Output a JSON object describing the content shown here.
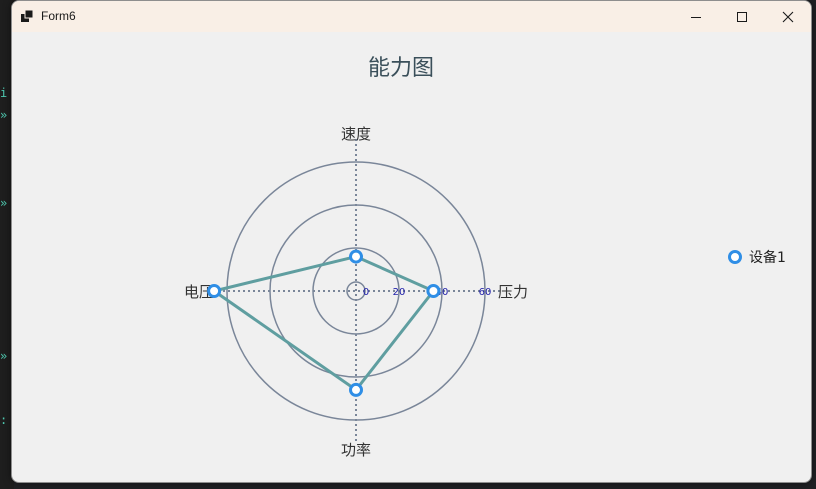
{
  "window": {
    "title": "Form6",
    "controls": [
      "minimize-icon",
      "maximize-icon",
      "close-icon"
    ]
  },
  "colors": {
    "titlebar": "#f9efe6",
    "background": "#f0f0f0",
    "grid": "#7a8699",
    "series_line": "#5f9ea0",
    "marker": "#2f8ee6",
    "title_text": "#3a4f5a",
    "tick_text": "#2222aa"
  },
  "chart_data": {
    "type": "radar",
    "title": "能力图",
    "indicators": [
      "压力",
      "速度",
      "电压",
      "功率"
    ],
    "max": 60,
    "rings": [
      20,
      40,
      60
    ],
    "radial_ticks": [
      "0",
      "20",
      "40",
      "60"
    ],
    "series": [
      {
        "name": "设备1",
        "values": [
          36,
          16,
          66,
          46
        ]
      }
    ],
    "legend": {
      "position": "right"
    },
    "grid": true
  }
}
